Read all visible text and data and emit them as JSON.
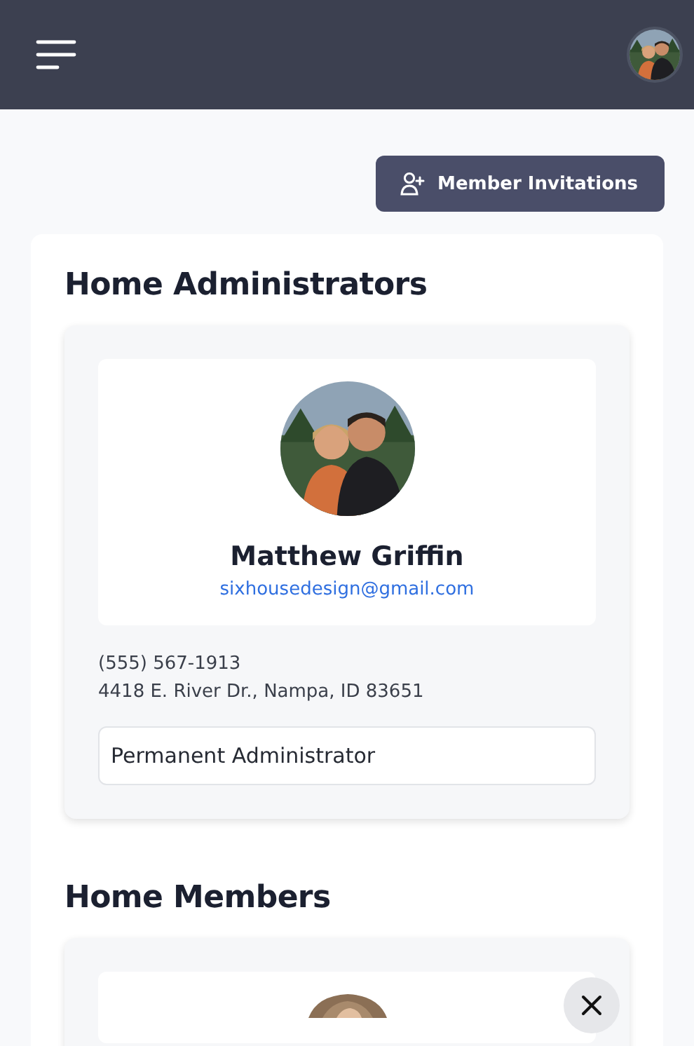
{
  "invite_button": {
    "label": "Member Invitations"
  },
  "administrators": {
    "title": "Home Administrators",
    "people": [
      {
        "name": "Matthew Griffin",
        "email": "sixhousedesign@gmail.com",
        "phone": "(555) 567-1913",
        "address": "4418 E. River Dr., Nampa, ID 83651",
        "role": "Permanent Administrator"
      }
    ]
  },
  "members": {
    "title": "Home Members"
  }
}
